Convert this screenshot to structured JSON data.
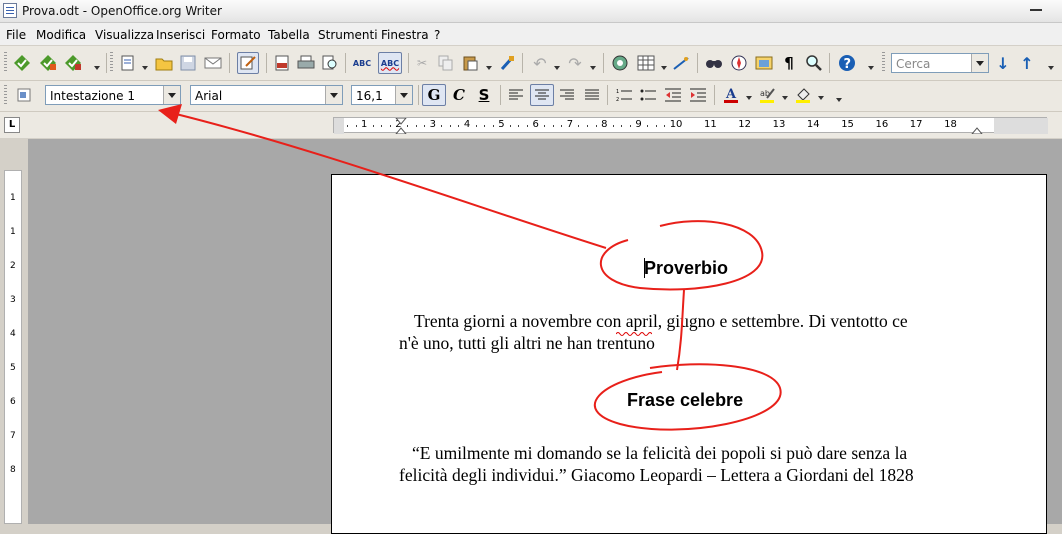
{
  "window": {
    "title": "Prova.odt - OpenOffice.org Writer"
  },
  "menu": [
    "File",
    "Modifica",
    "Visualizza",
    "Inserisci",
    "Formato",
    "Tabella",
    "Strumenti",
    "Finestra",
    "?"
  ],
  "toolbar": {
    "search_placeholder": "Cerca"
  },
  "format_bar": {
    "paragraph_style": "Intestazione 1",
    "font_name": "Arial",
    "font_size": "16,1",
    "bold_label": "G",
    "italic_label": "C",
    "underline_label": "S"
  },
  "ruler": {
    "marks": [
      "1",
      "2",
      "3",
      "4",
      "5",
      "6",
      "7",
      "8",
      "9",
      "10",
      "11",
      "12",
      "13",
      "14",
      "15",
      "16",
      "17",
      "18"
    ],
    "vmarks": [
      "1",
      "1",
      "2",
      "3",
      "4",
      "5",
      "6",
      "7",
      "8"
    ]
  },
  "document": {
    "heading1": "Proverbio",
    "para1_line1": "Trenta giorni a novembre con april, giugno e settembre. Di ventotto ce",
    "para1_line2": "n'è uno, tutti gli altri ne han trentuno",
    "heading2": "Frase celebre",
    "para2_line1": "“E umilmente mi domando se la felicità dei popoli si può dare senza la",
    "para2_line2": "felicità degli individui.” Giacomo Leopardi – Lettera a Giordani del 1828"
  }
}
